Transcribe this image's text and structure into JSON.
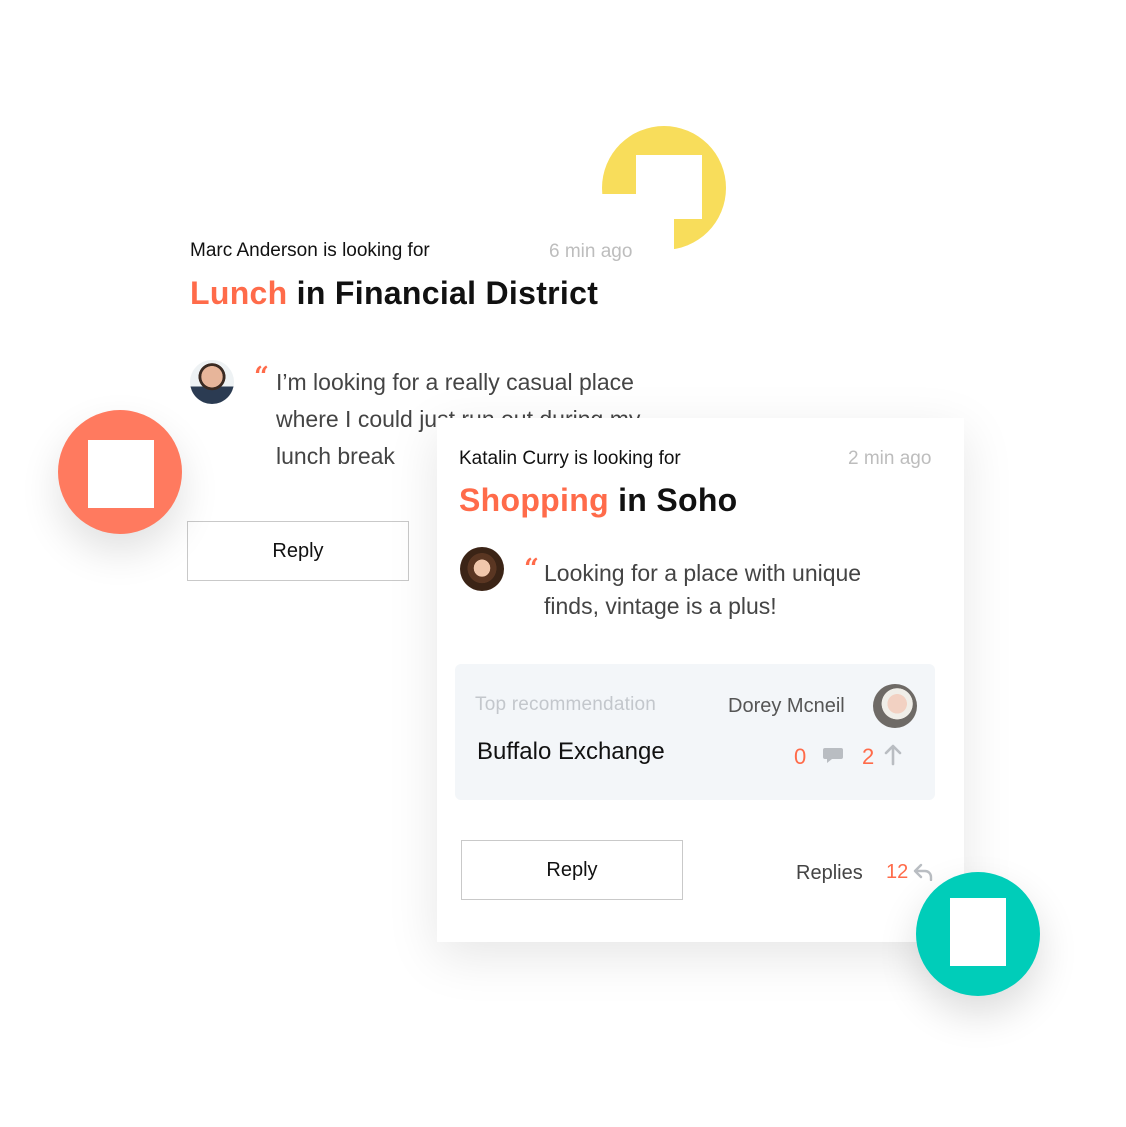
{
  "colors": {
    "accent": "#ff6b4a",
    "yellow": "#f8dd5b",
    "coral": "#ff7a5f",
    "teal": "#00cdb9",
    "muted": "#bdbdbd"
  },
  "card1": {
    "user_line": "Marc Anderson is looking for",
    "time": "6 min ago",
    "title_accent": "Lunch",
    "title_rest": " in Financial District",
    "quote": "I’m looking for a really casual place where I could just run out during my lunch break",
    "reply_label": "Reply",
    "avatar_icon": "user-avatar"
  },
  "card2": {
    "user_line": "Katalin Curry is looking for",
    "time": "2 min ago",
    "title_accent": "Shopping",
    "title_rest": " in Soho",
    "quote": "Looking for a place with unique finds, vintage is a plus!",
    "recommendation": {
      "label": "Top recommendation",
      "name": "Buffalo Exchange",
      "user": "Dorey Mcneil",
      "comments": "0",
      "upvotes": "2"
    },
    "reply_label": "Reply",
    "replies_label": "Replies",
    "replies_count": "12"
  },
  "icons": [
    "quote-icon",
    "comment-icon",
    "arrow-up-icon",
    "reply-arrow-icon"
  ]
}
